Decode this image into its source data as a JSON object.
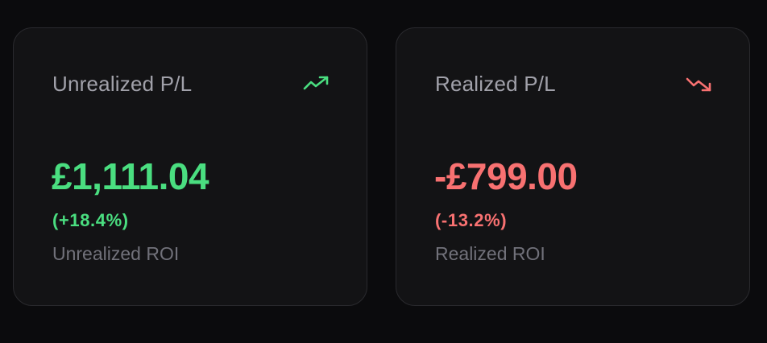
{
  "colors": {
    "positive": "#4ade80",
    "negative": "#f87171",
    "background": "#0b0b0d",
    "card": "#131315"
  },
  "cards": [
    {
      "title": "Unrealized P/L",
      "icon": "trending-up-icon",
      "amount": "£1,111.04",
      "percent": "(+18.4%)",
      "label": "Unrealized ROI"
    },
    {
      "title": "Realized P/L",
      "icon": "trending-down-icon",
      "amount": "-£799.00",
      "percent": "(-13.2%)",
      "label": "Realized ROI"
    }
  ]
}
